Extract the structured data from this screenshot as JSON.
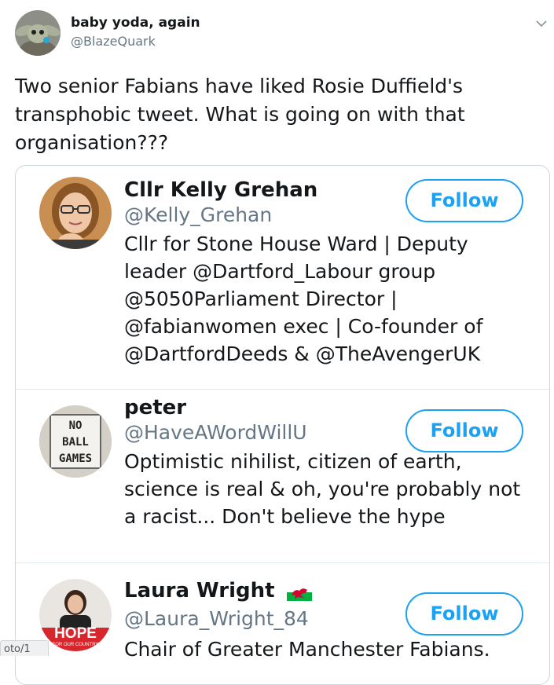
{
  "tweet": {
    "display_name": "baby yoda, again",
    "handle": "@BlazeQuark",
    "text": "Two senior Fabians have liked Rosie Duffield's transphobic tweet. What is going on with that organisation???",
    "menu_icon": "chevron-down-icon"
  },
  "card": {
    "users": [
      {
        "name": "Cllr Kelly Grehan",
        "handle": "@Kelly_Grehan",
        "bio": "Cllr for Stone House Ward | Deputy leader @Dartford_Labour group @5050Parliament Director | @fabianwomen exec | Co-founder of @DartfordDeeds & @TheAvengerUK",
        "follow_label": "Follow"
      },
      {
        "name": "peter",
        "handle": "@HaveAWordWillU",
        "bio": "Optimistic nihilist, citizen of earth, science is real & oh, you're probably not a racist... Don't believe the hype",
        "follow_label": "Follow",
        "avatar_sign": [
          "NO",
          "BALL",
          "GAMES"
        ]
      },
      {
        "name": "Laura Wright",
        "name_icon": "wales-flag-icon",
        "handle": "@Laura_Wright_84",
        "bio": "Chair of Greater Manchester Fabians.",
        "follow_label": "Follow",
        "avatar_sign": [
          "HOPE",
          "FOR OUR COUNTRY"
        ]
      }
    ]
  },
  "corner_tag": "oto/1",
  "colors": {
    "accent": "#1da1f2",
    "text": "#14171a",
    "secondary": "#657786",
    "border": "#ccd6dd"
  }
}
